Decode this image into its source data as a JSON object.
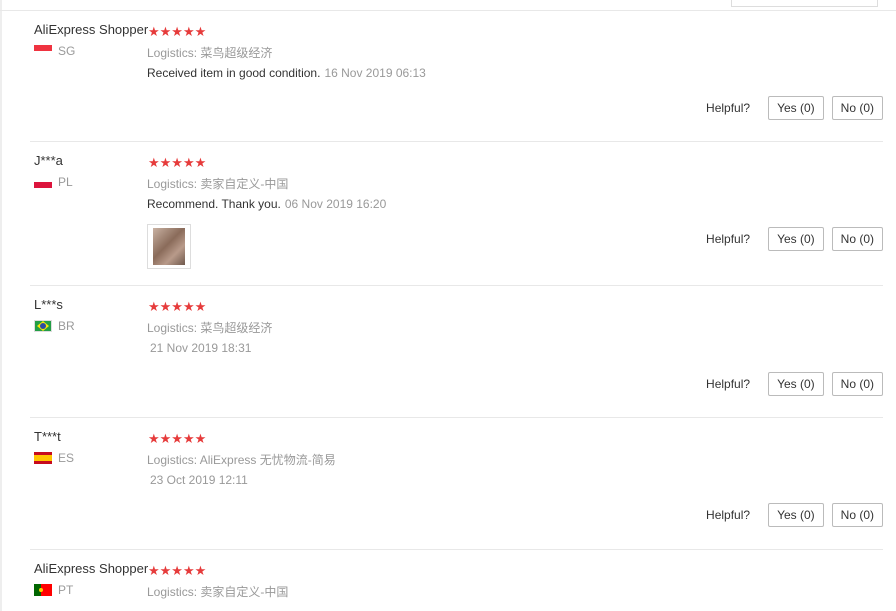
{
  "reviews": [
    {
      "user": "AliExpress Shopper",
      "country": "SG",
      "stars": "★★★★★",
      "logistics": "Logistics: 菜鸟超级经济",
      "feedback": "Received item in good condition.",
      "date": "16 Nov 2019 06:13",
      "helpful": "Helpful?",
      "yes": "Yes (0)",
      "no": "No (0)"
    },
    {
      "user": "J***a",
      "country": "PL",
      "stars": "★★★★★",
      "logistics": "Logistics: 卖家自定义-中国",
      "feedback": "Recommend. Thank you.",
      "date": "06 Nov 2019 16:20",
      "helpful": "Helpful?",
      "yes": "Yes (0)",
      "no": "No (0)"
    },
    {
      "user": "L***s",
      "country": "BR",
      "stars": "★★★★★",
      "logistics": "Logistics: 菜鸟超级经济",
      "date": "21 Nov 2019 18:31",
      "helpful": "Helpful?",
      "yes": "Yes (0)",
      "no": "No (0)"
    },
    {
      "user": "T***t",
      "country": "ES",
      "stars": "★★★★★",
      "logistics": "Logistics: AliExpress 无忧物流-简易",
      "date": "23 Oct 2019 12:11",
      "helpful": "Helpful?",
      "yes": "Yes (0)",
      "no": "No (0)"
    },
    {
      "user": "AliExpress Shopper",
      "country": "PT",
      "stars": "★★★★★",
      "logistics": "Logistics: 卖家自定义-中国"
    }
  ],
  "colors": {
    "star": "#e63b3b",
    "muted": "#999999",
    "border": "#e8e8e8"
  }
}
